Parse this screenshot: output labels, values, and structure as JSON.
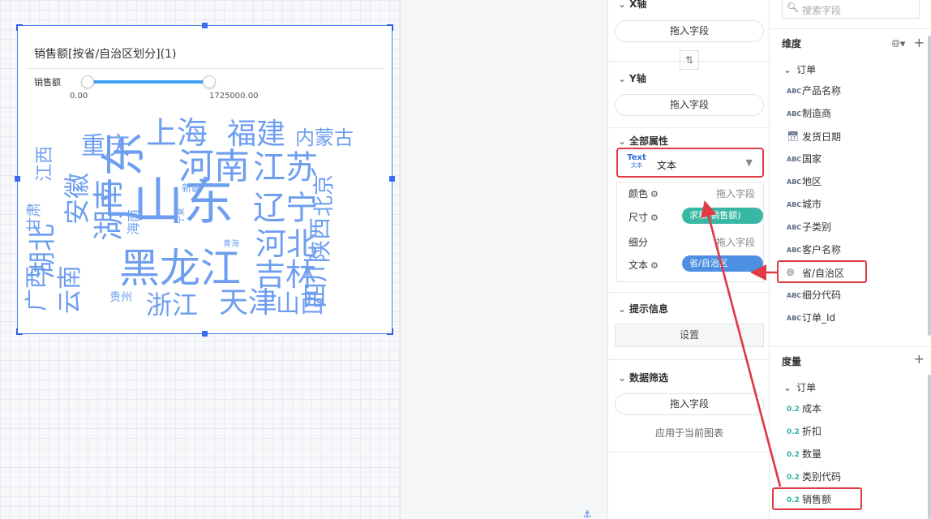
{
  "chart": {
    "title": "销售额[按省/自治区划分](1)",
    "legend_label": "销售额",
    "slider_min": "0.00",
    "slider_max": "1725000.00",
    "words": [
      "山东",
      "黑龙江",
      "河南",
      "江苏",
      "广东",
      "辽宁",
      "湖南",
      "河北",
      "上海",
      "福建",
      "湖北",
      "吉林",
      "天津",
      "山西",
      "四川",
      "浙江",
      "安徽",
      "重庆",
      "内蒙古",
      "北京",
      "陕西",
      "云南",
      "广西",
      "江西",
      "甘肃",
      "海南",
      "新疆",
      "贵州",
      "宁夏",
      "青海"
    ]
  },
  "mid_panel": {
    "x_axis": {
      "title": "X轴",
      "drop": "拖入字段"
    },
    "y_axis": {
      "title": "Y轴",
      "drop": "拖入字段"
    },
    "all_props": {
      "title": "全部属性",
      "type_icon_top": "Text",
      "type_icon_bottom": "文本",
      "type_label": "文本",
      "color_label": "颜色",
      "color_hint": "拖入字段",
      "size_label": "尺寸",
      "size_tag": "求和(销售额)",
      "detail_label": "细分",
      "detail_hint": "拖入字段",
      "text_label": "文本",
      "text_tag": "省/自治区"
    },
    "tooltip": {
      "title": "提示信息",
      "button": "设置"
    },
    "filter": {
      "title": "数据筛选",
      "drop": "拖入字段",
      "apply": "应用于当前图表"
    }
  },
  "right_panel": {
    "search_placeholder": "搜索字段",
    "dimension_title": "维度",
    "dimension_group": "订单",
    "dimensions": [
      {
        "icon": "ABC",
        "label": "产品名称"
      },
      {
        "icon": "ABC",
        "label": "制造商"
      },
      {
        "icon": "date",
        "label": "发货日期"
      },
      {
        "icon": "ABC",
        "label": "国家"
      },
      {
        "icon": "ABC",
        "label": "地区"
      },
      {
        "icon": "ABC",
        "label": "城市"
      },
      {
        "icon": "ABC",
        "label": "子类别"
      },
      {
        "icon": "ABC",
        "label": "客户名称"
      },
      {
        "icon": "geo",
        "label": "省/自治区"
      },
      {
        "icon": "ABC",
        "label": "细分代码"
      },
      {
        "icon": "ABC",
        "label": "订单_Id"
      }
    ],
    "measure_title": "度量",
    "measure_group": "订单",
    "measures": [
      {
        "icon": "0.2",
        "label": "成本"
      },
      {
        "icon": "0.2",
        "label": "折扣"
      },
      {
        "icon": "0.2",
        "label": "数量"
      },
      {
        "icon": "0.2",
        "label": "类别代码"
      },
      {
        "icon": "0.2",
        "label": "销售额"
      }
    ]
  },
  "colors": {
    "accent": "#3d9ff5",
    "word": "#6e9ef0",
    "highlight": "#e13a45",
    "tag_green": "#38b8a4",
    "tag_blue": "#4d8fe2"
  }
}
